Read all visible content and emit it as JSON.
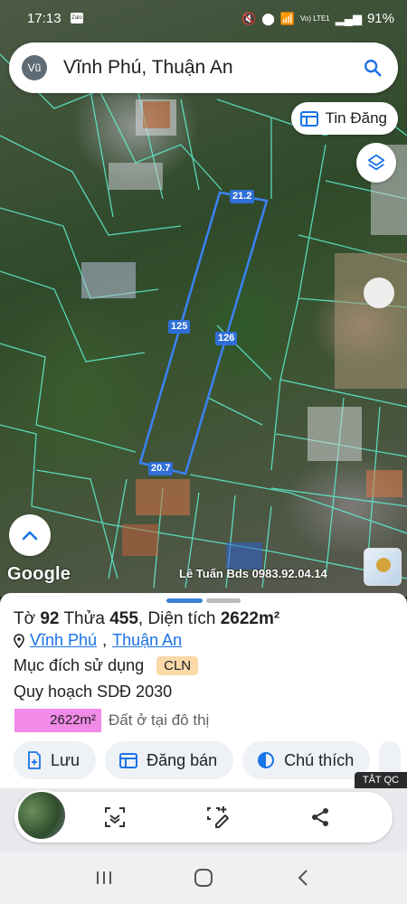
{
  "status": {
    "time": "17:13",
    "app_icon": "zalo",
    "battery": "91%",
    "network": "Vo) LTE1"
  },
  "search": {
    "avatar": "Vũ",
    "query": "Vĩnh Phú, Thuận An"
  },
  "map": {
    "tin_dang_label": "Tin Đăng",
    "edge_labels": [
      "21.2",
      "125",
      "126",
      "20.7"
    ],
    "brand": "Google",
    "watermark": "Lê Tuấn Bds 0983.92.04.14"
  },
  "parcel": {
    "sheet_prefix": "Tờ",
    "sheet_no": "92",
    "plot_prefix": "Thửa",
    "plot_no": "455",
    "area_prefix": "Diện tích",
    "area": "2622m²",
    "ward": "Vĩnh Phú",
    "district": "Thuận An",
    "purpose_label": "Mục đích sử dụng",
    "purpose_code": "CLN",
    "plan_label": "Quy hoạch SDĐ 2030",
    "plan_area": "2622m²",
    "plan_desc": "Đất ở tại đô thị"
  },
  "actions": {
    "save": "Lưu",
    "list_sale": "Đăng bán",
    "legend": "Chú thích"
  },
  "ad": {
    "label": "TẮT QC"
  },
  "colors": {
    "accent": "#1a73e8",
    "plan_highlight": "#f28ae8",
    "badge": "#fad8a8",
    "parcel_outline": "#3b82f6"
  }
}
